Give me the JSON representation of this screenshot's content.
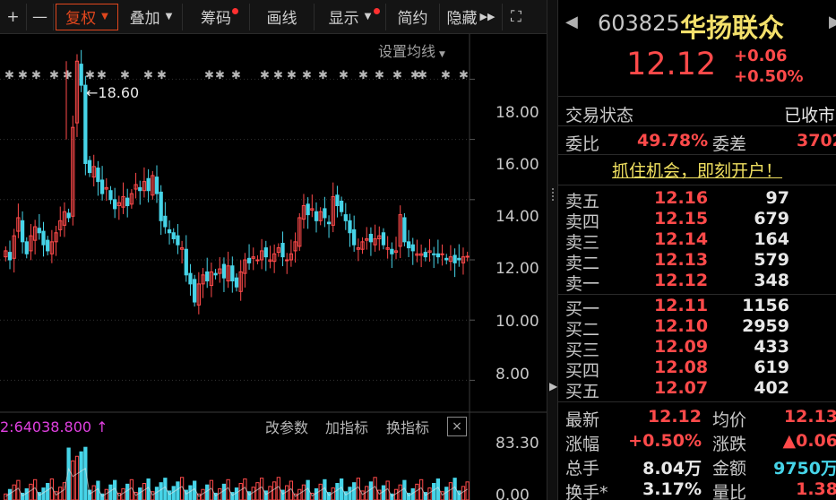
{
  "toolbar": {
    "plus": "+",
    "minus": "—",
    "fuquan": "复权",
    "diejia": "叠加",
    "chouma": "筹码",
    "huaxian": "画线",
    "xianshi": "显示",
    "jianyue": "简约",
    "yincang": "隐藏",
    "expand": "⛶"
  },
  "chart": {
    "ma_setting": "设置均线",
    "peak_label": "←18.60",
    "y_ticks": [
      "18.00",
      "16.00",
      "14.00",
      "12.00",
      "10.00",
      "8.00"
    ],
    "volume": {
      "value": "2:64038.800 ↑",
      "btn_params": "改参数",
      "btn_add": "加指标",
      "btn_switch": "换指标",
      "close": "×",
      "y_ticks": [
        "83.30",
        "0.00"
      ]
    }
  },
  "quote": {
    "code": "603825",
    "name": "华扬联众",
    "price": "12.12",
    "change": "+0.06",
    "change_pct": "+0.50%",
    "status_label": "交易状态",
    "status_value": "已收市",
    "weibi_label": "委比",
    "weibi_value": "49.78%",
    "weicha_label": "委差",
    "weicha_value": "3702",
    "promo": "抓住机会，即刻开户！",
    "asks": [
      {
        "label": "卖五",
        "price": "12.16",
        "vol": "97"
      },
      {
        "label": "卖四",
        "price": "12.15",
        "vol": "679"
      },
      {
        "label": "卖三",
        "price": "12.14",
        "vol": "164"
      },
      {
        "label": "卖二",
        "price": "12.13",
        "vol": "579"
      },
      {
        "label": "卖一",
        "price": "12.12",
        "vol": "348"
      }
    ],
    "bids": [
      {
        "label": "买一",
        "price": "12.11",
        "vol": "1156"
      },
      {
        "label": "买二",
        "price": "12.10",
        "vol": "2959"
      },
      {
        "label": "买三",
        "price": "12.09",
        "vol": "433"
      },
      {
        "label": "买四",
        "price": "12.08",
        "vol": "619"
      },
      {
        "label": "买五",
        "price": "12.07",
        "vol": "402"
      }
    ],
    "stats": [
      {
        "l1": "最新",
        "v1": "12.12",
        "l2": "均价",
        "v2": "12.13"
      },
      {
        "l1": "涨幅",
        "v1": "+0.50%",
        "l2": "涨跌",
        "v2": "▲0.06"
      },
      {
        "l1": "总手",
        "v1": "8.04万",
        "l2": "金额",
        "v2": "9750万"
      },
      {
        "l1": "换手*",
        "v1": "3.17%",
        "l2": "量比",
        "v2": "1.38"
      }
    ]
  },
  "colors": {
    "up": "#ff4a4a",
    "down": "#46d4e8",
    "name": "#f3e06b",
    "accent": "#e0461d"
  },
  "chart_data": {
    "type": "candlestick",
    "ylim": [
      7.0,
      19.5
    ],
    "y_ticks": [
      8,
      10,
      12,
      14,
      16,
      18
    ],
    "closes": [
      12.3,
      12.0,
      12.8,
      13.4,
      12.6,
      12.2,
      12.8,
      13.1,
      12.9,
      12.5,
      12.3,
      12.6,
      12.9,
      13.3,
      13.6,
      13.4,
      16.4,
      18.6,
      17.8,
      15.2,
      14.9,
      15.1,
      14.6,
      14.2,
      14.4,
      14.0,
      13.7,
      13.9,
      14.1,
      13.8,
      14.2,
      14.5,
      14.3,
      14.6,
      14.3,
      14.8,
      14.2,
      13.3,
      13.1,
      12.9,
      12.7,
      12.5,
      12.4,
      11.5,
      11.2,
      10.6,
      11.2,
      11.5,
      11.3,
      11.6,
      11.5,
      11.7,
      11.4,
      11.8,
      11.3,
      11.1,
      11.6,
      12.0,
      11.9,
      12.1,
      12.0,
      12.3,
      12.1,
      12.0,
      12.2,
      12.4,
      12.1,
      12.0,
      12.2,
      12.6,
      13.4,
      13.8,
      13.5,
      13.7,
      13.3,
      13.6,
      13.4,
      13.2,
      14.1,
      13.8,
      13.6,
      13.3,
      12.9,
      12.5,
      12.4,
      12.6,
      12.7,
      12.6,
      12.7,
      12.8,
      12.5,
      12.4,
      12.2,
      12.3,
      13.5,
      12.6,
      12.4,
      12.3,
      12.2,
      12.2,
      12.1,
      12.3,
      12.2,
      12.1,
      12.2,
      12.0,
      12.1,
      11.9,
      12.0,
      12.1,
      12.12
    ],
    "volume_ylim": [
      0,
      83.3
    ]
  }
}
